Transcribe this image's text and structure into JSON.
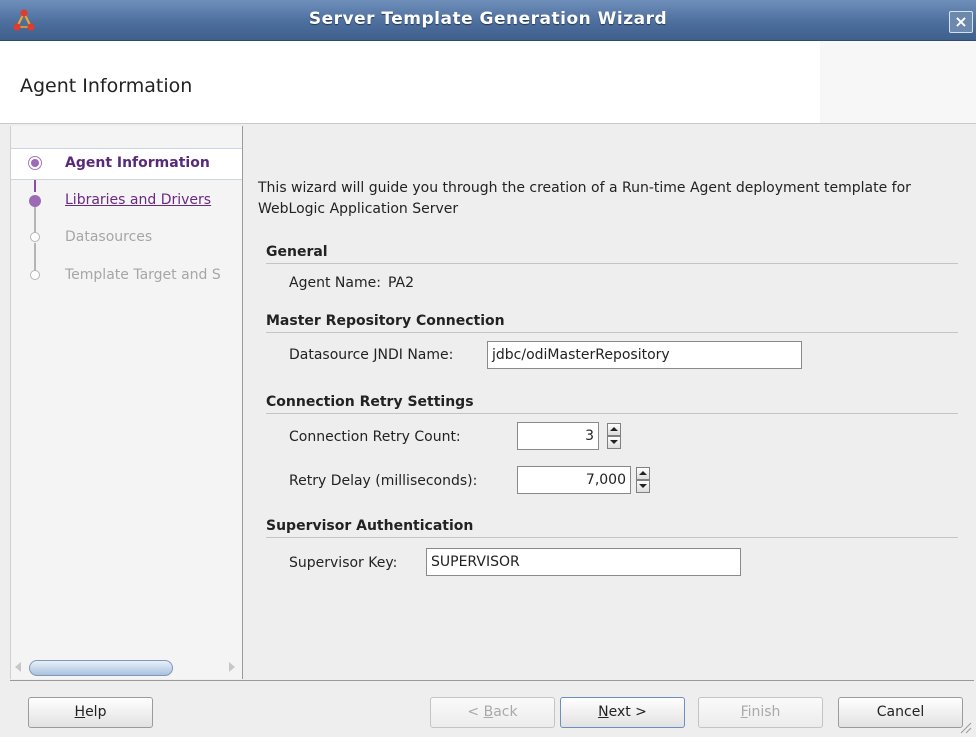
{
  "window": {
    "title": "Server Template Generation Wizard",
    "close_glyph": "×",
    "app_icon": "odi-network-icon"
  },
  "header": {
    "title": "Agent Information"
  },
  "steps": [
    {
      "label": "Agent Information",
      "state": "current"
    },
    {
      "label": "Libraries and Drivers",
      "state": "link"
    },
    {
      "label": "Datasources",
      "state": "disabled"
    },
    {
      "label": "Template Target and S",
      "state": "disabled"
    }
  ],
  "content": {
    "intro": "This wizard will guide you through the creation of a Run-time Agent deployment template for WebLogic Application Server",
    "general": {
      "title": "General",
      "agent_name_label": "Agent Name:",
      "agent_name_value": "PA2"
    },
    "master_repo": {
      "title": "Master Repository Connection",
      "jndi_label": "Datasource JNDI Name:",
      "jndi_value": "jdbc/odiMasterRepository"
    },
    "retry": {
      "title": "Connection Retry Settings",
      "count_label": "Connection Retry Count:",
      "count_value": "3",
      "delay_label": "Retry Delay (milliseconds):",
      "delay_value": "7,000"
    },
    "supervisor": {
      "title": "Supervisor Authentication",
      "key_label": "Supervisor Key:",
      "key_value": "SUPERVISOR"
    }
  },
  "buttons": {
    "help": {
      "mnemonic": "H",
      "rest": "elp"
    },
    "back": {
      "prefix": "< ",
      "mnemonic": "B",
      "rest": "ack"
    },
    "next": {
      "mnemonic": "N",
      "rest": "ext >"
    },
    "finish": {
      "mnemonic": "F",
      "rest": "inish"
    },
    "cancel": "Cancel"
  },
  "colors": {
    "titlebar": "#4d6f9e",
    "step_current": "#5a2a7a",
    "step_link": "#6a2a82",
    "step_disabled": "#a6a6a6"
  }
}
